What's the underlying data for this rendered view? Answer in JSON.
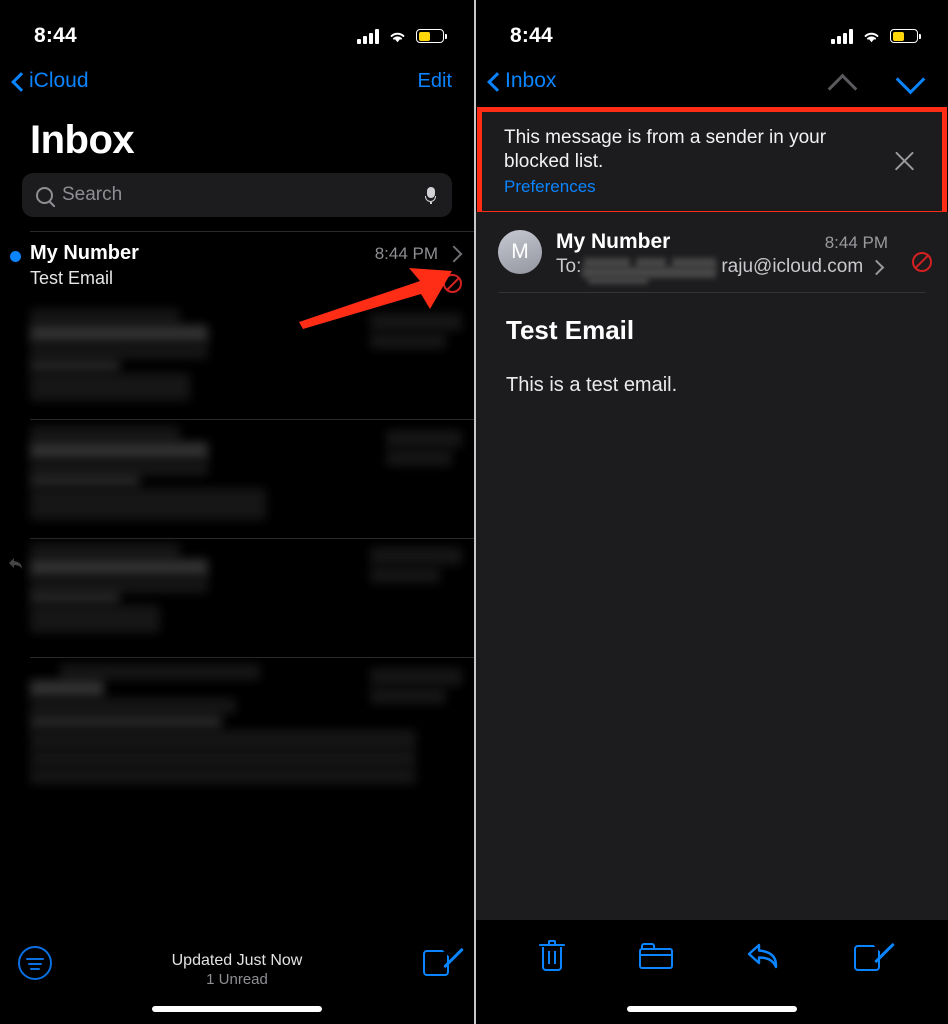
{
  "left_panel": {
    "status_bar": {
      "time": "8:44",
      "signal_icon": "cellular-bars-icon",
      "wifi_icon": "wifi-icon",
      "battery_icon": "battery-low-power-icon",
      "battery_color": "#ffd60a"
    },
    "nav": {
      "back_label": "iCloud",
      "back_icon": "chevron-left-icon",
      "edit_label": "Edit"
    },
    "title": "Inbox",
    "search": {
      "placeholder": "Search",
      "search_icon": "search-icon",
      "mic_icon": "microphone-icon"
    },
    "message_row": {
      "sender": "My Number",
      "subject": "Test Email",
      "time": "8:44 PM",
      "unread_dot": true,
      "disclosure_icon": "chevron-right-icon",
      "blocked_icon": "blocked-sender-icon",
      "blocked_icon_color": "#d32020"
    },
    "redacted_rows": [
      {
        "label": "redacted-message-row-1"
      },
      {
        "label": "redacted-message-row-2"
      },
      {
        "label": "redacted-message-row-3"
      },
      {
        "label": "redacted-message-row-4"
      }
    ],
    "bottom_bar": {
      "filter_icon": "filter-icon",
      "status_primary": "Updated Just Now",
      "status_secondary": "1 Unread",
      "compose_icon": "compose-icon"
    }
  },
  "right_panel": {
    "status_bar": {
      "time": "8:44",
      "signal_icon": "cellular-bars-icon",
      "wifi_icon": "wifi-icon",
      "battery_icon": "battery-low-power-icon"
    },
    "nav": {
      "back_label": "Inbox",
      "back_icon": "chevron-left-icon",
      "prev_icon": "chevron-up-icon",
      "next_icon": "chevron-down-icon",
      "prev_enabled": false,
      "next_enabled": true
    },
    "banner": {
      "text": "This message is from a sender in your blocked list.",
      "link_label": "Preferences",
      "close_icon": "close-x-icon",
      "highlight_color": "#ff2d16",
      "background": "#1c1c1e"
    },
    "message": {
      "avatar_initial": "M",
      "sender": "My Number",
      "time": "8:44 PM",
      "to_label": "To:",
      "to_address": "raju@icloud.com",
      "to_redacted": true,
      "details_icon": "chevron-right-icon",
      "blocked_icon": "blocked-sender-icon",
      "subject": "Test Email",
      "body": "This is a test email."
    },
    "bottom_bar": {
      "trash_icon": "trash-icon",
      "folder_icon": "folder-icon",
      "reply_icon": "reply-icon",
      "compose_icon": "compose-icon"
    }
  },
  "annotation": {
    "arrow_color": "#ff2d16",
    "arrow_target": "blocked-sender-icon"
  }
}
